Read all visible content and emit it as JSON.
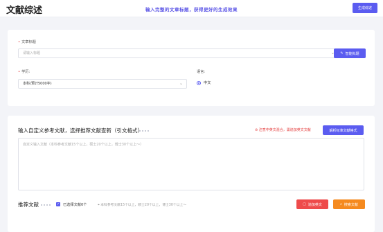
{
  "header": {
    "title": "文献综述",
    "slogan": "输入完整的文章标题，获得更好的生成效果",
    "generate_button": "生成综述"
  },
  "form": {
    "article_title_label": "文章标题",
    "article_title_placeholder": "请输入标题",
    "smart_title_button": "智能拟题",
    "degree_label": "学历:",
    "degree_value": "本科(预计5000字)",
    "language_label": "语言:",
    "language_value": "中文"
  },
  "references": {
    "section_title": "输入自定义参考文献，选择推荐文献查新（引文格式）",
    "warning": "注意中英文混合，需追加英文文献",
    "parse_button": "解析标准文献格式",
    "textarea_placeholder": "自定义输入文献（本科参考文献15个以上，硕士20个以上，博士30个以上～）"
  },
  "recommend": {
    "section_title": "推荐文献",
    "selected_label": "已选择文献0个",
    "hint": "本科参考文献15个以上，硕士20个以上，博士30个以上～",
    "add_button": "追加英文",
    "search_button": "搜索文献"
  },
  "icons": {
    "smart": "magic-icon",
    "warning": "warning-icon",
    "location": "pin-icon",
    "add": "document-icon",
    "search": "search-icon"
  },
  "colors": {
    "accent": "#5b5cf0",
    "danger": "#ee4b4b",
    "orange": "#f58a1f"
  }
}
